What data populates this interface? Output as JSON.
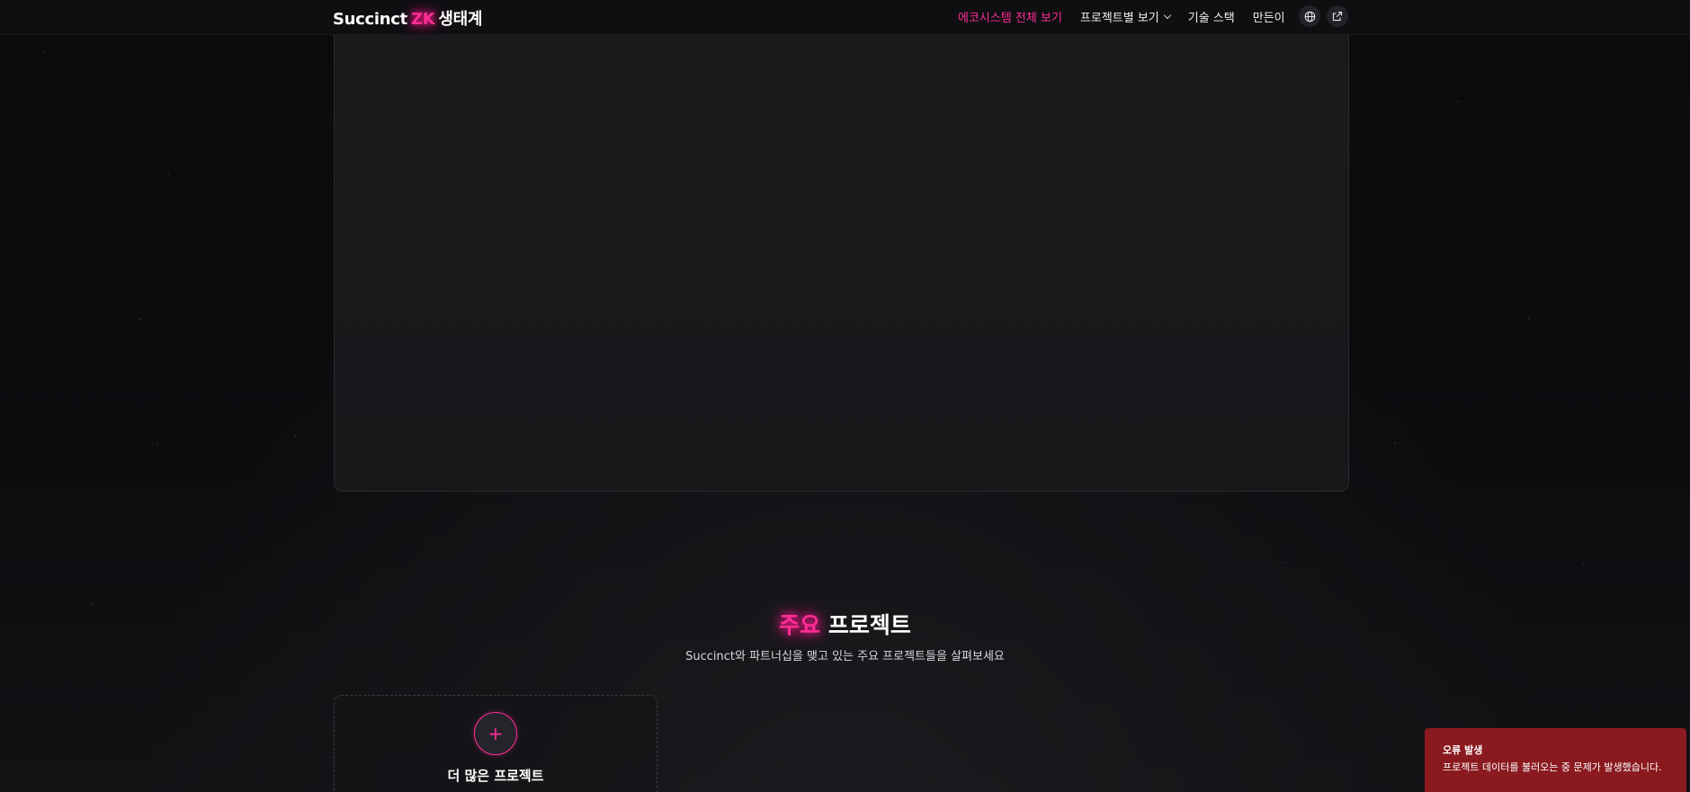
{
  "header": {
    "logo_prefix": "Succinct",
    "logo_accent": "ZK",
    "logo_suffix": "생태계",
    "nav": [
      {
        "label": "에코시스템 전체 보기",
        "active": true
      },
      {
        "label": "프로젝트별 보기",
        "dropdown": true
      },
      {
        "label": "기술 스택"
      },
      {
        "label": "만든이"
      }
    ],
    "icons": [
      "globe-icon",
      "external-link-icon"
    ]
  },
  "section": {
    "title_accent": "주요",
    "title_rest": "프로젝트",
    "subtitle": "Succinct와 파트너십을 맺고 있는 주요 프로젝트들을 살펴보세요"
  },
  "more_card": {
    "icon": "plus-icon",
    "label": "더 많은 프로젝트"
  },
  "toast": {
    "title": "오류 발생",
    "message": "프로젝트 데이터를 불러오는 중 문제가 발생했습니다."
  },
  "colors": {
    "accent": "#ff2d95",
    "background": "#0c0c0e",
    "toast_error": "#8a1a1f"
  }
}
